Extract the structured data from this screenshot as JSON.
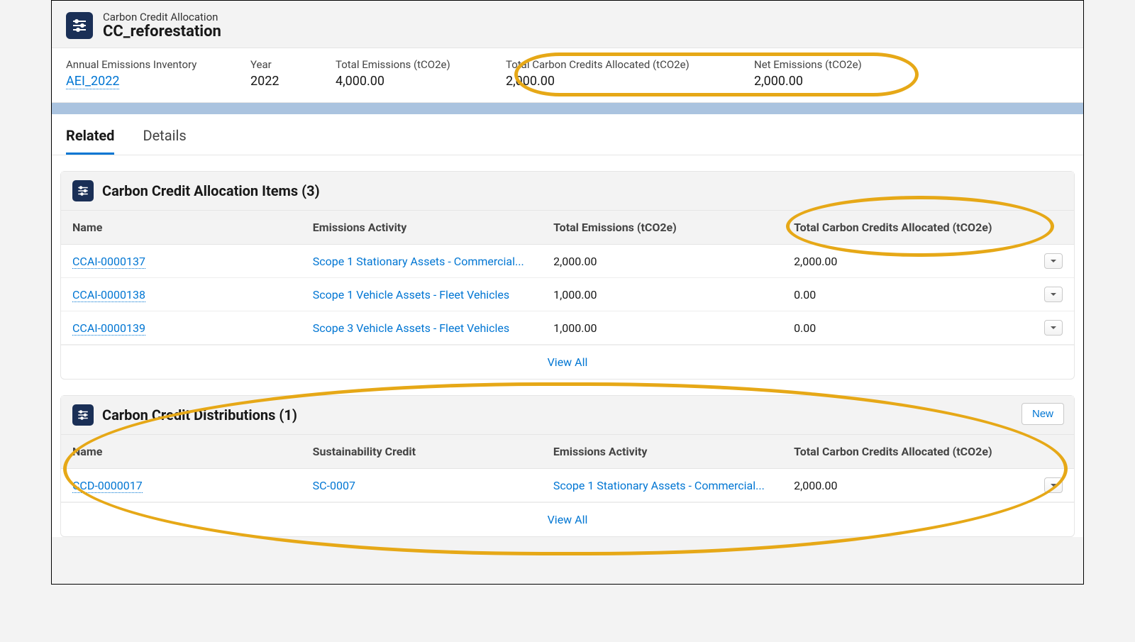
{
  "header": {
    "subtitle": "Carbon Credit Allocation",
    "title": "CC_reforestation"
  },
  "highlights": {
    "inventory": {
      "label": "Annual Emissions Inventory",
      "value": "AEI_2022"
    },
    "year": {
      "label": "Year",
      "value": "2022"
    },
    "total": {
      "label": "Total Emissions (tCO2e)",
      "value": "4,000.00"
    },
    "credits": {
      "label": "Total Carbon Credits Allocated (tCO2e)",
      "value": "2,000.00"
    },
    "net": {
      "label": "Net Emissions (tCO2e)",
      "value": "2,000.00"
    }
  },
  "tabs": {
    "related": "Related",
    "details": "Details"
  },
  "card1": {
    "title": "Carbon Credit Allocation Items (3)",
    "cols": {
      "name": "Name",
      "activity": "Emissions Activity",
      "total": "Total Emissions (tCO2e)",
      "credits": "Total Carbon Credits Allocated (tCO2e)"
    },
    "rows": [
      {
        "name": "CCAI-0000137",
        "activity": "Scope 1 Stationary Assets - Commercial...",
        "total": "2,000.00",
        "credits": "2,000.00"
      },
      {
        "name": "CCAI-0000138",
        "activity": "Scope 1 Vehicle Assets - Fleet Vehicles",
        "total": "1,000.00",
        "credits": "0.00"
      },
      {
        "name": "CCAI-0000139",
        "activity": "Scope 3 Vehicle Assets - Fleet Vehicles",
        "total": "1,000.00",
        "credits": "0.00"
      }
    ],
    "viewAll": "View All"
  },
  "card2": {
    "title": "Carbon Credit Distributions (1)",
    "newLabel": "New",
    "cols": {
      "name": "Name",
      "credit": "Sustainability Credit",
      "activity": "Emissions Activity",
      "credits": "Total Carbon Credits Allocated (tCO2e)"
    },
    "rows": [
      {
        "name": "CCD-0000017",
        "credit": "SC-0007",
        "activity": "Scope 1 Stationary Assets - Commercial...",
        "credits": "2,000.00"
      }
    ],
    "viewAll": "View All"
  }
}
